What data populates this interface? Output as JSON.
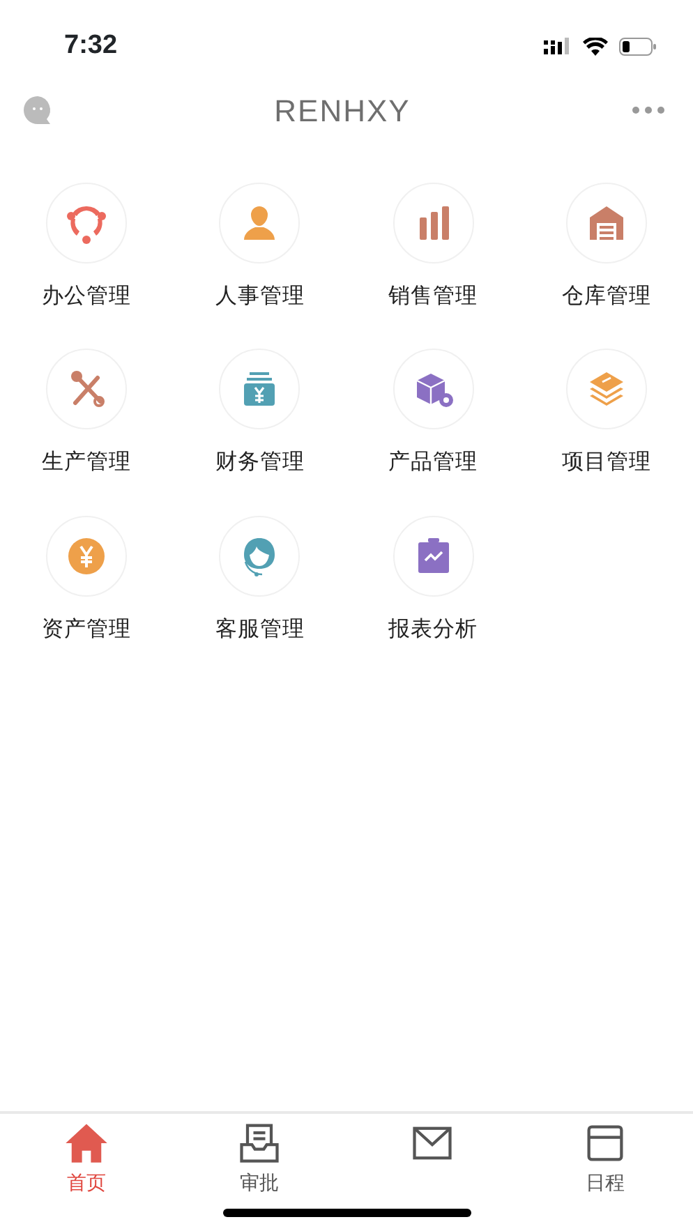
{
  "status_bar": {
    "time": "7:32"
  },
  "header": {
    "title": "RENHXY"
  },
  "modules": [
    {
      "label": "办公管理"
    },
    {
      "label": "人事管理"
    },
    {
      "label": "销售管理"
    },
    {
      "label": "仓库管理"
    },
    {
      "label": "生产管理"
    },
    {
      "label": "财务管理"
    },
    {
      "label": "产品管理"
    },
    {
      "label": "项目管理"
    },
    {
      "label": "资产管理"
    },
    {
      "label": "客服管理"
    },
    {
      "label": "报表分析"
    }
  ],
  "tab_bar": [
    {
      "label": "首页",
      "selected": true
    },
    {
      "label": "审批",
      "selected": false
    },
    {
      "selected": false
    },
    {
      "label": "日程",
      "selected": false
    }
  ]
}
